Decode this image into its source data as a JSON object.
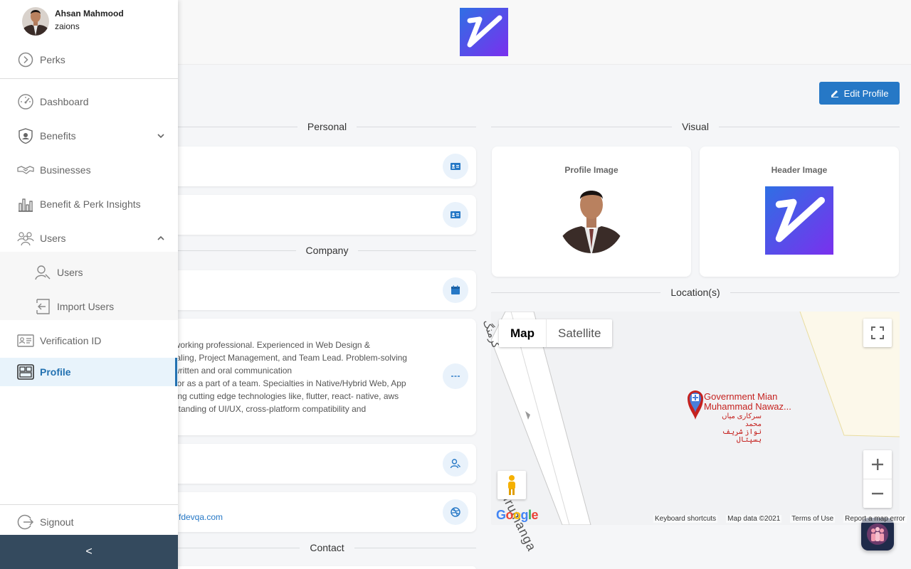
{
  "user": {
    "name": "Ahsan Mahmood",
    "org": "zaions"
  },
  "nav": {
    "perks": "Perks",
    "dashboard": "Dashboard",
    "benefits": "Benefits",
    "businesses": "Businesses",
    "insights": "Benefit & Perk Insights",
    "users": "Users",
    "users_sub": "Users",
    "import_users": "Import Users",
    "verification": "Verification ID",
    "profile": "Profile",
    "signout": "Signout",
    "collapse": "<"
  },
  "header": {
    "edit_profile": "Edit Profile"
  },
  "sections": {
    "personal": "Personal",
    "company": "Company",
    "contact": "Contact",
    "visual": "Visual",
    "locations": "Location(s)"
  },
  "summary_lines": [
    "d-working professional. Experienced in Web Design &",
    "dealing, Project Management, and Team Lead. Problem-solving",
    "d written and oral communication",
    "lly or as a part of a team. Specialties in Native/Hybrid Web, App",
    "using cutting edge technologies like, flutter, react- native, aws",
    "erstanding of UI/UX, cross-platform compatibility and"
  ],
  "website_text": "fdevqa.com",
  "visual": {
    "profile_image": "Profile Image",
    "header_image": "Header Image"
  },
  "map": {
    "tab_map": "Map",
    "tab_satellite": "Satellite",
    "place_line1": "Government Mian",
    "place_line2": "Muhammad Nawaz...",
    "place_urdu1": "سرکاری میاں محمد",
    "place_urdu2": "نواز شریف ہسپتال",
    "road": "Gurumanga",
    "road_top": "کرمنگ",
    "footer": [
      "Keyboard shortcuts",
      "Map data ©2021",
      "Terms of Use",
      "Report a map error"
    ],
    "google": "Google"
  },
  "colors": {
    "accent": "#2678c6",
    "sidebar_footer": "#344a5e",
    "active_bg": "#e8f3fb"
  }
}
